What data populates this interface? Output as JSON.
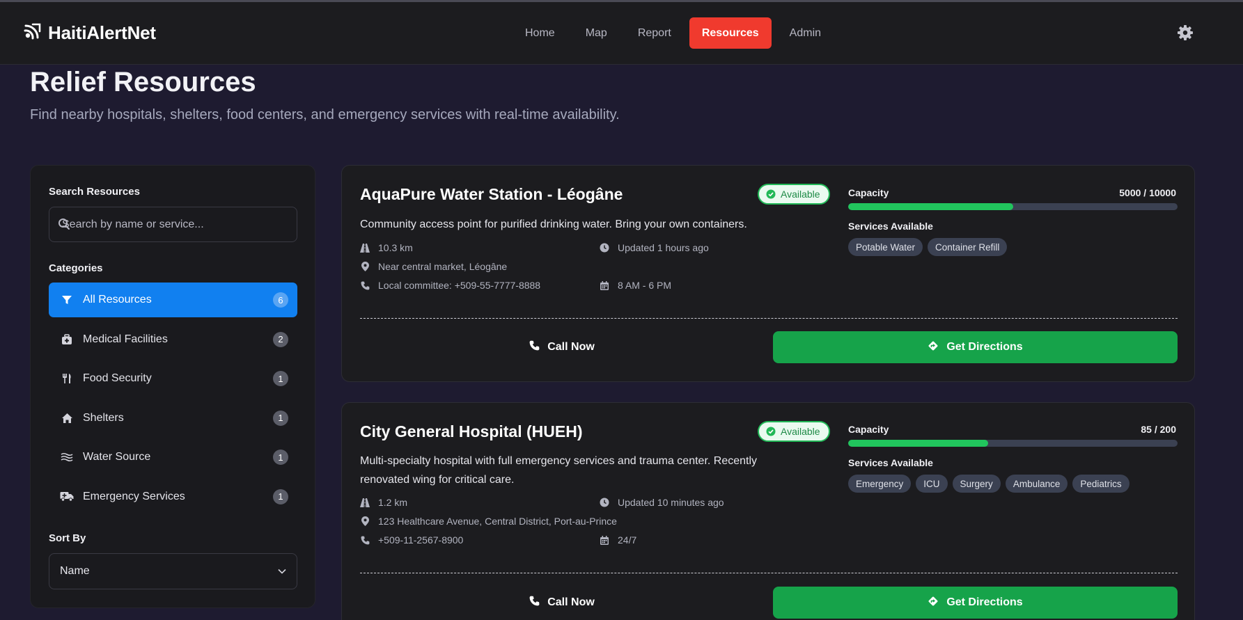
{
  "app": {
    "name": "HaitiAlertNet"
  },
  "nav": {
    "items": [
      {
        "label": "Home"
      },
      {
        "label": "Map"
      },
      {
        "label": "Report"
      },
      {
        "label": "Resources",
        "active": true
      },
      {
        "label": "Admin"
      }
    ]
  },
  "page": {
    "title": "Relief Resources",
    "subtitle": "Find nearby hospitals, shelters, food centers, and emergency services with real-time availability."
  },
  "sidebar": {
    "search_label": "Search Resources",
    "search_placeholder": "Search by name or service...",
    "categories_label": "Categories",
    "categories": [
      {
        "label": "All Resources",
        "count": "6",
        "icon": "filter-icon",
        "active": true
      },
      {
        "label": "Medical Facilities",
        "count": "2",
        "icon": "medical-kit-icon"
      },
      {
        "label": "Food Security",
        "count": "1",
        "icon": "utensils-icon"
      },
      {
        "label": "Shelters",
        "count": "1",
        "icon": "house-icon"
      },
      {
        "label": "Water Source",
        "count": "1",
        "icon": "water-icon"
      },
      {
        "label": "Emergency Services",
        "count": "1",
        "icon": "truck-medical-icon"
      }
    ],
    "sort_label": "Sort By",
    "sort_value": "Name"
  },
  "resources": [
    {
      "name": "AquaPure Water Station - Léogâne",
      "status": "Available",
      "description": "Community access point for purified drinking water. Bring your own containers.",
      "distance": "10.3 km",
      "updated": "Updated 1 hours ago",
      "address": "Near central market, Léogâne",
      "phone": "Local committee: +509-55-7777-8888",
      "hours": "8 AM - 6 PM",
      "capacity_label": "Capacity",
      "capacity": "5000 / 10000",
      "capacity_fraction": 0.5,
      "services_label": "Services Available",
      "services": [
        "Potable Water",
        "Container Refill"
      ],
      "call_label": "Call Now",
      "directions_label": "Get Directions"
    },
    {
      "name": "City General Hospital (HUEH)",
      "status": "Available",
      "description": "Multi-specialty hospital with full emergency services and trauma center. Recently renovated wing for critical care.",
      "distance": "1.2 km",
      "updated": "Updated 10 minutes ago",
      "address": "123 Healthcare Avenue, Central District, Port-au-Prince",
      "phone": "+509-11-2567-8900",
      "hours": "24/7",
      "capacity_label": "Capacity",
      "capacity": "85 / 200",
      "capacity_fraction": 0.425,
      "services_label": "Services Available",
      "services": [
        "Emergency",
        "ICU",
        "Surgery",
        "Ambulance",
        "Pediatrics"
      ],
      "call_label": "Call Now",
      "directions_label": "Get Directions"
    }
  ],
  "colors": {
    "accent_red": "#f03a2e",
    "accent_blue": "#1180f0",
    "accent_green": "#16a34a",
    "capacity_green": "#21c55d"
  }
}
